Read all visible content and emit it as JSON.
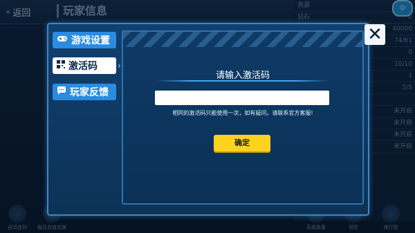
{
  "topbar": {
    "back_label": "返回",
    "title": "玩家信息"
  },
  "resources": {
    "header": "资源",
    "rows": [
      {
        "label": "钻石",
        "value": "0"
      },
      {
        "label": "",
        "value": "40000"
      },
      {
        "label": "",
        "value": "74/61"
      },
      {
        "label": "",
        "value": "0"
      },
      {
        "label": "",
        "value": "10/10"
      },
      {
        "label": "",
        "value": "1"
      },
      {
        "label": "",
        "value": "5/5"
      },
      {
        "label": "",
        "value": ""
      },
      {
        "label": "",
        "value": "未开启"
      },
      {
        "label": "",
        "value": "未开启"
      },
      {
        "label": "",
        "value": "未开启"
      },
      {
        "label": "",
        "value": "未开启"
      }
    ]
  },
  "bottom": {
    "items": [
      {
        "label": "自动连利"
      },
      {
        "label": "每日充值兑换"
      },
      {
        "label": "系统装备"
      },
      {
        "label": "领奖"
      },
      {
        "label": "排行榜"
      }
    ]
  },
  "dialog": {
    "menu": [
      {
        "label": "游戏设置",
        "icon": "gamepad-icon",
        "active": false
      },
      {
        "label": "激活码",
        "icon": "qr-code-icon",
        "active": true
      },
      {
        "label": "玩家反馈",
        "icon": "chat-bubble-icon",
        "active": false
      }
    ],
    "close_label": "✕",
    "heading": "请输入激活码",
    "input": {
      "value": "",
      "placeholder": ""
    },
    "hint": "相同的激活码只能使用一次，如有疑问，请联系官方客服!",
    "confirm_label": "确定"
  },
  "colors": {
    "accent": "#2a8be0",
    "confirm": "#ffd21f",
    "panel": "#0e3a66"
  }
}
